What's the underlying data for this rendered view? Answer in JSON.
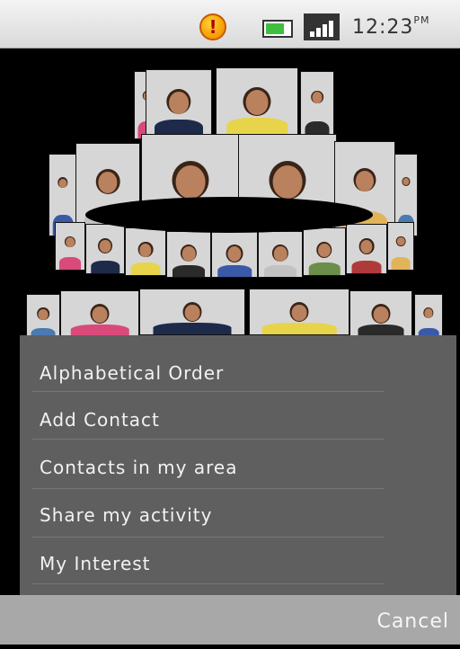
{
  "status_bar": {
    "time": "12:23",
    "ampm": "PM",
    "icons": [
      "alert-icon",
      "battery-icon",
      "signal-icon"
    ]
  },
  "carousel": {
    "photo_count_visible": 27,
    "theme": "contact-photo-ring"
  },
  "menu": {
    "items": [
      {
        "label": "Alphabetical Order"
      },
      {
        "label": "Add Contact"
      },
      {
        "label": "Contacts in my area"
      },
      {
        "label": "Share my activity"
      },
      {
        "label": "My Interest"
      }
    ],
    "cancel_label": "Cancel"
  }
}
